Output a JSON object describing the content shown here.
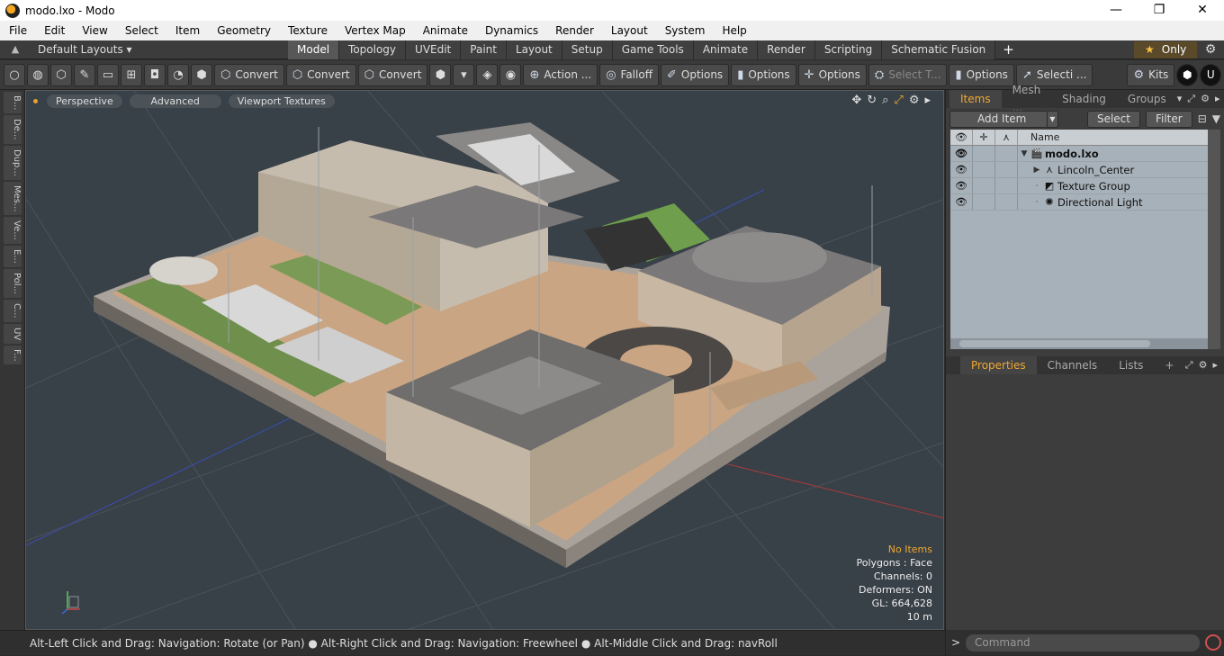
{
  "window": {
    "title": "modo.lxo - Modo",
    "minimize": "—",
    "maximize": "❐",
    "close": "✕"
  },
  "menu": [
    "File",
    "Edit",
    "View",
    "Select",
    "Item",
    "Geometry",
    "Texture",
    "Vertex Map",
    "Animate",
    "Dynamics",
    "Render",
    "Layout",
    "System",
    "Help"
  ],
  "layoutbar": {
    "layout_dropdown": "Default Layouts ▾",
    "tabs": [
      "Model",
      "Topology",
      "UVEdit",
      "Paint",
      "Layout",
      "Setup",
      "Game Tools",
      "Animate",
      "Render",
      "Scripting",
      "Schematic Fusion"
    ],
    "active_tab": "Model",
    "only_label": "Only"
  },
  "toolbar": {
    "convert1": "Convert",
    "convert2": "Convert",
    "convert3": "Convert",
    "action": "Action ...",
    "falloff": "Falloff",
    "options1": "Options",
    "options2": "Options",
    "options3": "Options",
    "select_t": "Select T...",
    "options4": "Options",
    "selecti": "Selecti ...",
    "kits": "Kits"
  },
  "leftstrip": [
    "B...",
    "De...",
    "Dup...",
    "Mes...",
    "Ve...",
    "E...",
    "Pol...",
    "C...",
    "UV",
    "F..."
  ],
  "viewport": {
    "perspective": "Perspective",
    "advanced": "Advanced",
    "textures": "Viewport Textures",
    "info": {
      "no_items": "No Items",
      "polygons": "Polygons : Face",
      "channels": "Channels: 0",
      "deformers": "Deformers: ON",
      "gl": "GL: 664,628",
      "scale": "10 m"
    }
  },
  "status": "Alt-Left Click and Drag: Navigation: Rotate (or Pan) ● Alt-Right Click and Drag: Navigation: Freewheel ● Alt-Middle Click and Drag: navRoll",
  "items_panel": {
    "tabs": [
      "Items",
      "Mesh ...",
      "Shading",
      "Groups"
    ],
    "add_item": "Add Item",
    "select": "Select",
    "filter": "Filter",
    "name_header": "Name",
    "rows": [
      {
        "name": "modo.lxo",
        "eye": "👁"
      },
      {
        "name": "Lincoln_Center",
        "eye": "👁"
      },
      {
        "name": "Texture Group",
        "eye": "👁"
      },
      {
        "name": "Directional Light",
        "eye": "👁"
      }
    ]
  },
  "props_panel": {
    "tabs": [
      "Properties",
      "Channels",
      "Lists"
    ]
  },
  "command": {
    "placeholder": "Command"
  },
  "colors": {
    "accent": "#f0a830",
    "viewport_bg": "#384048",
    "items_bg": "#a7b1b9"
  }
}
